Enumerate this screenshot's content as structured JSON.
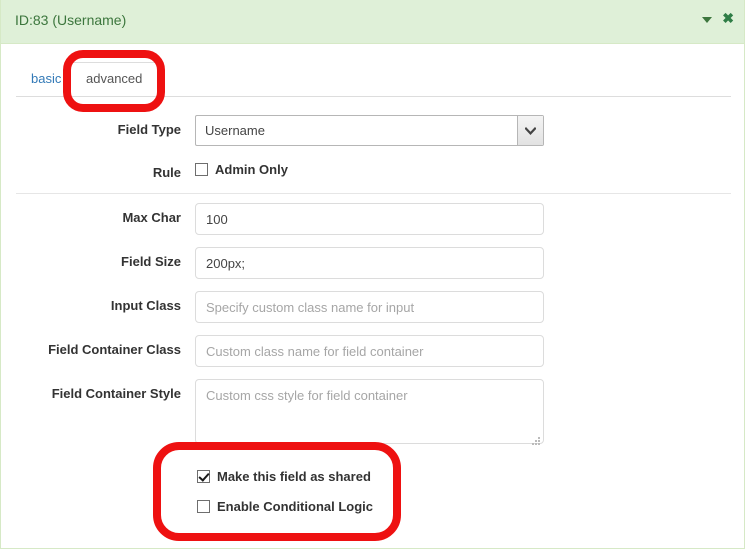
{
  "window": {
    "title": "ID:83 (Username)",
    "header_bg": "#dff0d8",
    "header_text_color": "#3c763d",
    "collapse_icon": "caret-down-icon",
    "close_icon": "close-x-icon",
    "close_label": "✖"
  },
  "tabs": {
    "items": [
      {
        "label": "basic",
        "active": false
      },
      {
        "label": "advanced",
        "active": true
      }
    ],
    "basic_label": "basic",
    "advanced_label": "advanced"
  },
  "form": {
    "field_type": {
      "label": "Field Type",
      "value": "Username",
      "options": [
        "Username"
      ],
      "caret_icon": "chevron-down-icon"
    },
    "rule": {
      "label": "Rule",
      "checkbox_label": "Admin Only",
      "checked": false
    },
    "max_char": {
      "label": "Max Char",
      "value": "100",
      "placeholder": ""
    },
    "field_size": {
      "label": "Field Size",
      "value": "200px;",
      "placeholder": ""
    },
    "input_class": {
      "label": "Input Class",
      "value": "",
      "placeholder": "Specify custom class name for input"
    },
    "field_container_class": {
      "label": "Field Container Class",
      "value": "",
      "placeholder": "Custom class name for field container"
    },
    "field_container_style": {
      "label": "Field Container Style",
      "value": "",
      "placeholder": "Custom css style for field container"
    },
    "shared": {
      "label": "Make this field as shared",
      "checked": true
    },
    "conditional_logic": {
      "label": "Enable Conditional Logic",
      "checked": false
    }
  },
  "annotations": {
    "color": "#ee1111",
    "highlight_tab": "advanced",
    "highlight_checkboxes": "Make this field as shared / Enable Conditional Logic"
  }
}
